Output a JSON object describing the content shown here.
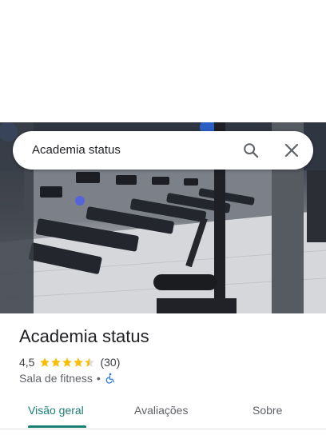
{
  "search": {
    "query": "Academia status",
    "search_icon": "search-icon",
    "close_icon": "close-icon"
  },
  "hero": {
    "image": "gym-interior-photo"
  },
  "place": {
    "name": "Academia status",
    "rating": "4,5",
    "rating_value": 4.5,
    "reviews": "(30)",
    "category": "Sala de fitness",
    "separator": "•",
    "accessibility_icon": "wheelchair-icon"
  },
  "tabs": [
    {
      "label": "Visão geral",
      "active": true
    },
    {
      "label": "Avaliações",
      "active": false
    },
    {
      "label": "Sobre",
      "active": false
    }
  ],
  "colors": {
    "accent": "#1a7f74",
    "star": "#fbbc04",
    "accessibility": "#1a73e8"
  }
}
